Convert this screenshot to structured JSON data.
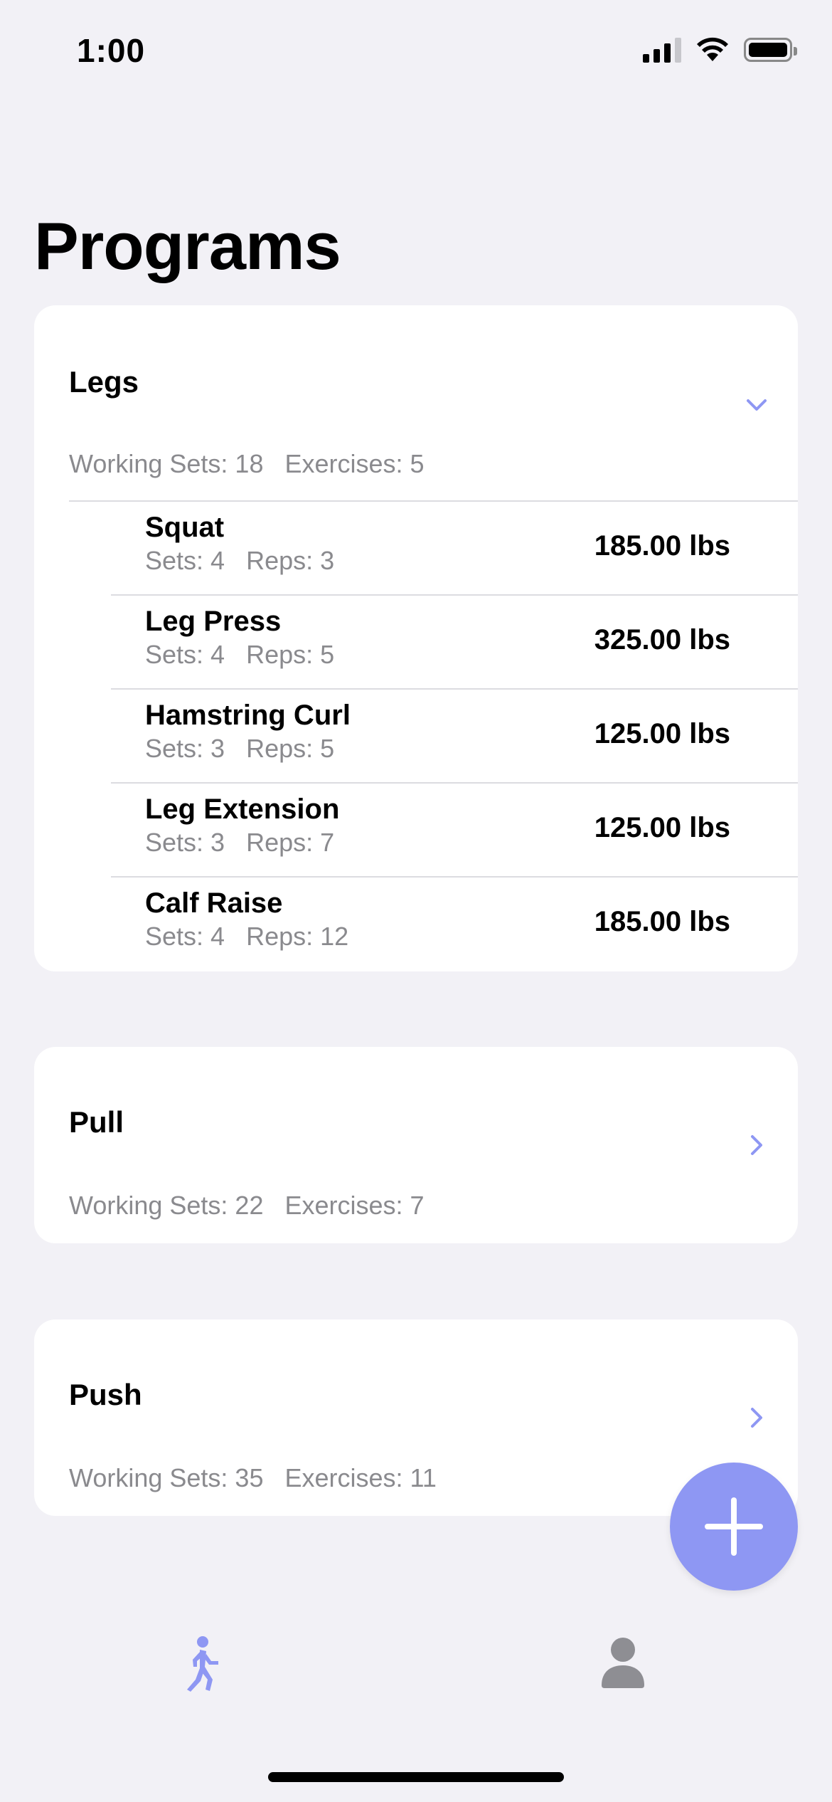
{
  "status_bar": {
    "time": "1:00"
  },
  "page_title": "Programs",
  "programs": [
    {
      "name": "Legs",
      "working_sets": "Working Sets: 18",
      "exercises_count": "Exercises: 5",
      "expanded": true,
      "exercises": [
        {
          "name": "Squat",
          "sets": "Sets: 4",
          "reps": "Reps: 3",
          "weight": "185.00 lbs"
        },
        {
          "name": "Leg Press",
          "sets": "Sets: 4",
          "reps": "Reps: 5",
          "weight": "325.00 lbs"
        },
        {
          "name": "Hamstring Curl",
          "sets": "Sets: 3",
          "reps": "Reps: 5",
          "weight": "125.00 lbs"
        },
        {
          "name": "Leg Extension",
          "sets": "Sets: 3",
          "reps": "Reps: 7",
          "weight": "125.00 lbs"
        },
        {
          "name": "Calf Raise",
          "sets": "Sets: 4",
          "reps": "Reps: 12",
          "weight": "185.00 lbs"
        }
      ]
    },
    {
      "name": "Pull",
      "working_sets": "Working Sets: 22",
      "exercises_count": "Exercises: 7",
      "expanded": false
    },
    {
      "name": "Push",
      "working_sets": "Working Sets: 35",
      "exercises_count": "Exercises: 11",
      "expanded": false
    }
  ],
  "fab": {
    "icon": "plus-icon"
  },
  "tab_bar": [
    {
      "icon": "walk-icon",
      "active": true
    },
    {
      "icon": "person-icon",
      "active": false
    }
  ],
  "colors": {
    "accent": "#8e97f3",
    "background": "#f2f1f6",
    "secondary_text": "#8a8a8e",
    "inactive_tab": "#8e8e93"
  }
}
